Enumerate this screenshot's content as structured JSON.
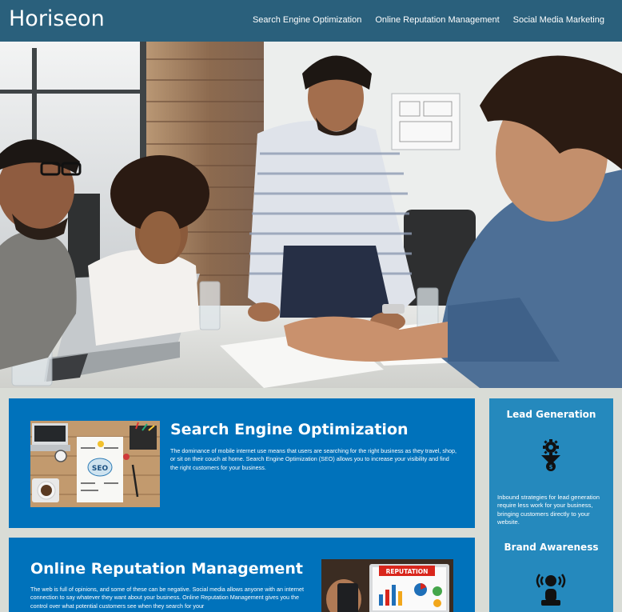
{
  "header": {
    "logo": "Horiseon",
    "nav": [
      {
        "label": "Search Engine Optimization"
      },
      {
        "label": "Online Reputation Management"
      },
      {
        "label": "Social Media Marketing"
      }
    ]
  },
  "main": {
    "seo": {
      "title": "Search Engine Optimization",
      "body": "The dominance of mobile internet use means that users are searching for the right business as they travel, shop, or sit on their couch at home. Search Engine Optimization (SEO) allows you to increase your visibility and find the right customers for your business."
    },
    "orm": {
      "title": "Online Reputation Management",
      "body": "The web is full of opinions, and some of these can be negative. Social media allows anyone with an internet connection to say whatever they want about your business. Online Reputation Management gives you the control over what potential customers see when they search for your"
    }
  },
  "sidebar": {
    "lead": {
      "title": "Lead Generation",
      "body": "Inbound strategies for lead generation require less work for your business, bringing customers directly to your website."
    },
    "brand": {
      "title": "Brand Awareness"
    }
  },
  "colors": {
    "header_bg": "#2a607c",
    "card_bg": "#0072bb",
    "sidebar_bg": "#2589bd",
    "page_bg": "#d9dcd6"
  },
  "icons": [
    "lead-generation-icon",
    "brand-awareness-icon"
  ],
  "images": {
    "seo_image_text": "SEO",
    "orm_image_text": "REPUTATION"
  }
}
